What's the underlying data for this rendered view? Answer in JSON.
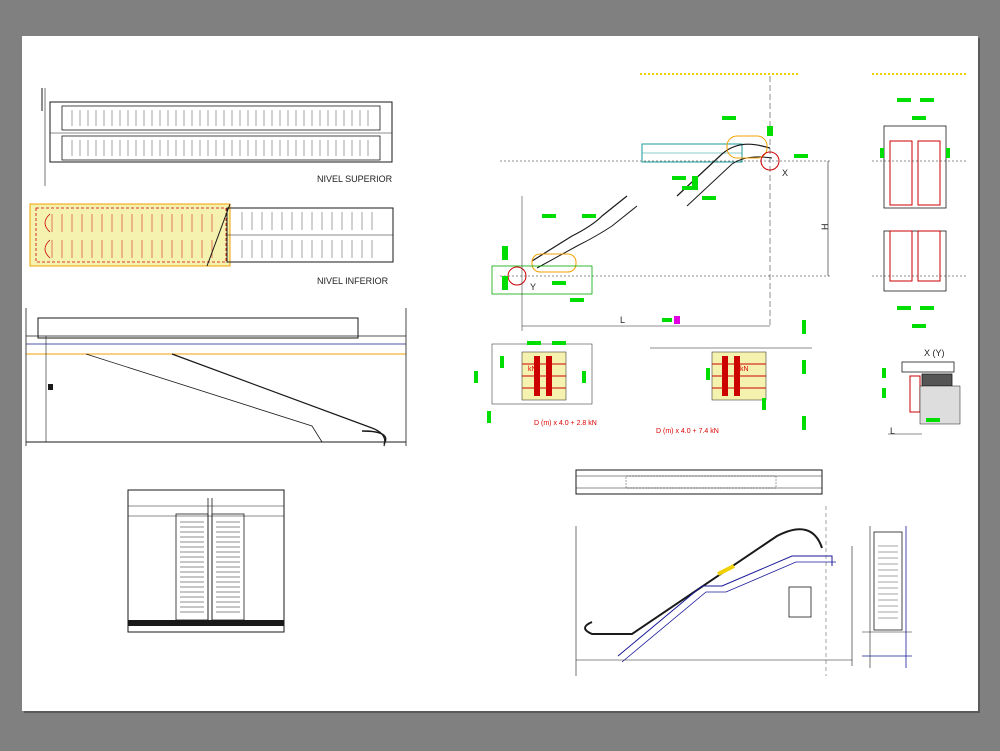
{
  "colors": {
    "background": "#808080",
    "sheet": "#ffffff",
    "line": "#1a1a1a",
    "blue": "#1a1a9a",
    "green": "#00dd00",
    "red": "#cc0000",
    "orange": "#f0a000",
    "yellow": "#f3f0a0",
    "magenta": "#e000e0"
  },
  "labels": {
    "nivel_superior": "NIVEL SUPERIOR",
    "nivel_inferior": "NIVEL INFERIOR",
    "label_x": "X",
    "label_y": "Y",
    "label_l": "L",
    "label_h": "H",
    "detail_xy": "X (Y)",
    "detail_l": "L",
    "load_label_left": "D (m) x 4.0 + 2.8 kN",
    "load_label_right": "D (m) x 4.0 + 7.4 kN",
    "kn": "kN"
  }
}
